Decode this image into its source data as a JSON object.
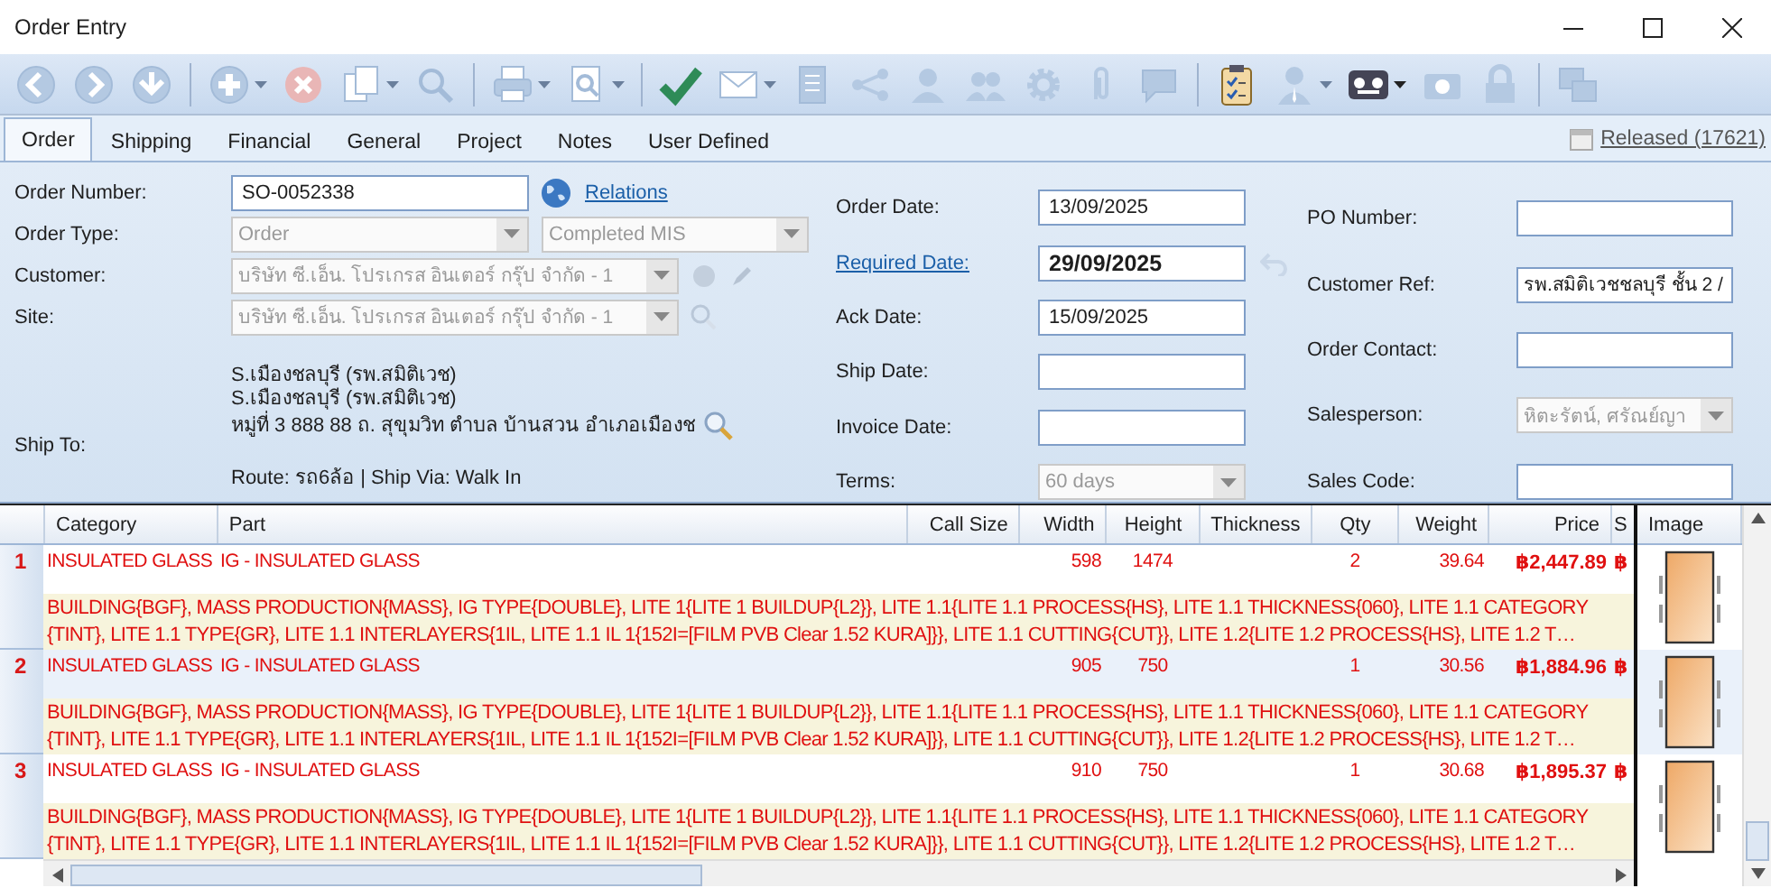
{
  "window": {
    "title": "Order Entry"
  },
  "window_controls": [
    {
      "kind": "minimize"
    },
    {
      "kind": "maximize"
    },
    {
      "kind": "close"
    }
  ],
  "toolbar": [
    {
      "kind": "back",
      "disabled": true,
      "dropdown": false
    },
    {
      "kind": "forward",
      "disabled": true,
      "dropdown": false
    },
    {
      "kind": "down",
      "disabled": true,
      "dropdown": false
    },
    {
      "kind": "separator"
    },
    {
      "kind": "add",
      "disabled": true,
      "dropdown": true
    },
    {
      "kind": "cancel",
      "disabled": true,
      "dropdown": false
    },
    {
      "kind": "copy",
      "disabled": true,
      "dropdown": true
    },
    {
      "kind": "search",
      "disabled": true,
      "dropdown": false
    },
    {
      "kind": "separator"
    },
    {
      "kind": "print",
      "disabled": true,
      "dropdown": true
    },
    {
      "kind": "preview",
      "disabled": true,
      "dropdown": true
    },
    {
      "kind": "separator"
    },
    {
      "kind": "check",
      "disabled": false,
      "dropdown": false
    },
    {
      "kind": "mail",
      "disabled": true,
      "dropdown": true
    },
    {
      "kind": "list",
      "disabled": true,
      "dropdown": false
    },
    {
      "kind": "share",
      "disabled": true,
      "dropdown": false
    },
    {
      "kind": "person",
      "disabled": true,
      "dropdown": false
    },
    {
      "kind": "people",
      "disabled": true,
      "dropdown": false
    },
    {
      "kind": "gear",
      "disabled": true,
      "dropdown": false
    },
    {
      "kind": "clip",
      "disabled": true,
      "dropdown": false
    },
    {
      "kind": "chat",
      "disabled": true,
      "dropdown": false
    },
    {
      "kind": "separator"
    },
    {
      "kind": "clipboard",
      "disabled": false,
      "dropdown": false
    },
    {
      "kind": "user",
      "disabled": true,
      "dropdown": true
    },
    {
      "kind": "device",
      "disabled": false,
      "dropdown": true
    },
    {
      "kind": "camera",
      "disabled": true,
      "dropdown": false
    },
    {
      "kind": "lock",
      "disabled": true,
      "dropdown": false
    },
    {
      "kind": "separator"
    },
    {
      "kind": "windows",
      "disabled": true,
      "dropdown": false
    }
  ],
  "tabs": [
    {
      "label": "Order",
      "selected": true
    },
    {
      "label": "Shipping",
      "selected": false
    },
    {
      "label": "Financial",
      "selected": false
    },
    {
      "label": "General",
      "selected": false
    },
    {
      "label": "Project",
      "selected": false
    },
    {
      "label": "Notes",
      "selected": false
    },
    {
      "label": "User Defined",
      "selected": false
    }
  ],
  "status_link": "Released (17621)",
  "form": {
    "order_number": {
      "label": "Order Number:",
      "value": "SO-0052338"
    },
    "relations_link": "Relations",
    "order_type": {
      "label": "Order Type:",
      "value": "Order",
      "disabled": true
    },
    "order_status": {
      "value": "Completed MIS",
      "disabled": true
    },
    "customer": {
      "label": "Customer:",
      "value": "บริษัท ซี.เอ็น. โปรเกรส อินเตอร์ กรุ๊ป  จำกัด - 1",
      "disabled": true
    },
    "site": {
      "label": "Site:",
      "value": "บริษัท ซี.เอ็น. โปรเกรส อินเตอร์ กรุ๊ป  จำกัด - 1",
      "disabled": true
    },
    "ship_to": {
      "label": "Ship To:",
      "lines": [
        "S.เมืองชลบุรี (รพ.สมิติเวช)",
        "S.เมืองชลบุรี (รพ.สมิติเวช)",
        "หมู่ที่ 3 888 88 ถ. สุขุมวิท ตำบล บ้านสวน อำเภอเมืองช"
      ],
      "route": "Route: รถ6ล้อ  |  Ship Via: Walk In"
    },
    "dates": [
      {
        "label": "Order Date:",
        "kind": "text",
        "value": "13/09/2025",
        "link": false
      },
      {
        "label": "Required Date:",
        "kind": "text",
        "value": "29/09/2025",
        "link": true,
        "bold": true
      },
      {
        "label": "Ack Date:",
        "kind": "text",
        "value": "15/09/2025",
        "link": false
      },
      {
        "label": "Ship Date:",
        "kind": "text",
        "link": false
      },
      {
        "label": "Invoice Date:",
        "kind": "text",
        "link": false
      },
      {
        "label": "Terms:",
        "kind": "dropdown",
        "value": "60 days",
        "link": false,
        "disabled": true
      }
    ],
    "refs": [
      {
        "label": "PO Number:",
        "kind": "text"
      },
      {
        "label": "Customer Ref:",
        "kind": "text",
        "value": "รพ.สมิติเวชชลบุรี ชั้น 2 /"
      },
      {
        "label": "Order Contact:",
        "kind": "text"
      },
      {
        "label": "Salesperson:",
        "kind": "dropdown",
        "value": "หิตะรัตน์, ศรัณย์ญา",
        "disabled": true
      },
      {
        "label": "Sales Code:",
        "kind": "text"
      }
    ]
  },
  "grid": {
    "columns": [
      {
        "label": "Category"
      },
      {
        "label": "Part"
      },
      {
        "label": "Call Size"
      },
      {
        "label": "Width"
      },
      {
        "label": "Height"
      },
      {
        "label": "Thickness"
      },
      {
        "label": "Qty"
      },
      {
        "label": "Weight"
      },
      {
        "label": "Price"
      },
      {
        "label": "S"
      }
    ],
    "image_column": "Image",
    "rows": [
      {
        "number": "1",
        "cells": [
          "INSULATED GLASS",
          "IG - INSULATED GLASS",
          "",
          "598",
          "1474",
          "",
          "2",
          "39.64",
          "฿2,447.89",
          "฿"
        ],
        "description": [
          "BUILDING{BGF}, MASS PRODUCTION{MASS}, IG TYPE{DOUBLE}, LITE 1{LITE 1 BUILDUP{L2}}, LITE 1.1{LITE 1.1 PROCESS{HS}, LITE 1.1 THICKNESS{060}, LITE 1.1 CATEGORY",
          "{TINT}, LITE 1.1 TYPE{GR}, LITE 1.1 INTERLAYERS{1IL, LITE 1.1 IL 1{152I=[FILM PVB Clear 1.52 KURA]}}, LITE 1.1 CUTTING{CUT}}, LITE 1.2{LITE 1.2 PROCESS{HS}, LITE 1.2 T…"
        ]
      },
      {
        "number": "2",
        "cells": [
          "INSULATED GLASS",
          "IG - INSULATED GLASS",
          "",
          "905",
          "750",
          "",
          "1",
          "30.56",
          "฿1,884.96",
          "฿"
        ],
        "description": [
          "BUILDING{BGF}, MASS PRODUCTION{MASS}, IG TYPE{DOUBLE}, LITE 1{LITE 1 BUILDUP{L2}}, LITE 1.1{LITE 1.1 PROCESS{HS}, LITE 1.1 THICKNESS{060}, LITE 1.1 CATEGORY",
          "{TINT}, LITE 1.1 TYPE{GR}, LITE 1.1 INTERLAYERS{1IL, LITE 1.1 IL 1{152I=[FILM PVB Clear 1.52 KURA]}}, LITE 1.1 CUTTING{CUT}}, LITE 1.2{LITE 1.2 PROCESS{HS}, LITE 1.2 T…"
        ]
      },
      {
        "number": "3",
        "cells": [
          "INSULATED GLASS",
          "IG - INSULATED GLASS",
          "",
          "910",
          "750",
          "",
          "1",
          "30.68",
          "฿1,895.37",
          "฿"
        ],
        "description": [
          "BUILDING{BGF}, MASS PRODUCTION{MASS}, IG TYPE{DOUBLE}, LITE 1{LITE 1 BUILDUP{L2}}, LITE 1.1{LITE 1.1 PROCESS{HS}, LITE 1.1 THICKNESS{060}, LITE 1.1 CATEGORY",
          "{TINT}, LITE 1.1 TYPE{GR}, LITE 1.1 INTERLAYERS{1IL, LITE 1.1 IL 1{152I=[FILM PVB Clear 1.52 KURA]}}, LITE 1.1 CUTTING{CUT}}, LITE 1.2{LITE 1.2 PROCESS{HS}, LITE 1.2 T…"
        ]
      }
    ]
  }
}
